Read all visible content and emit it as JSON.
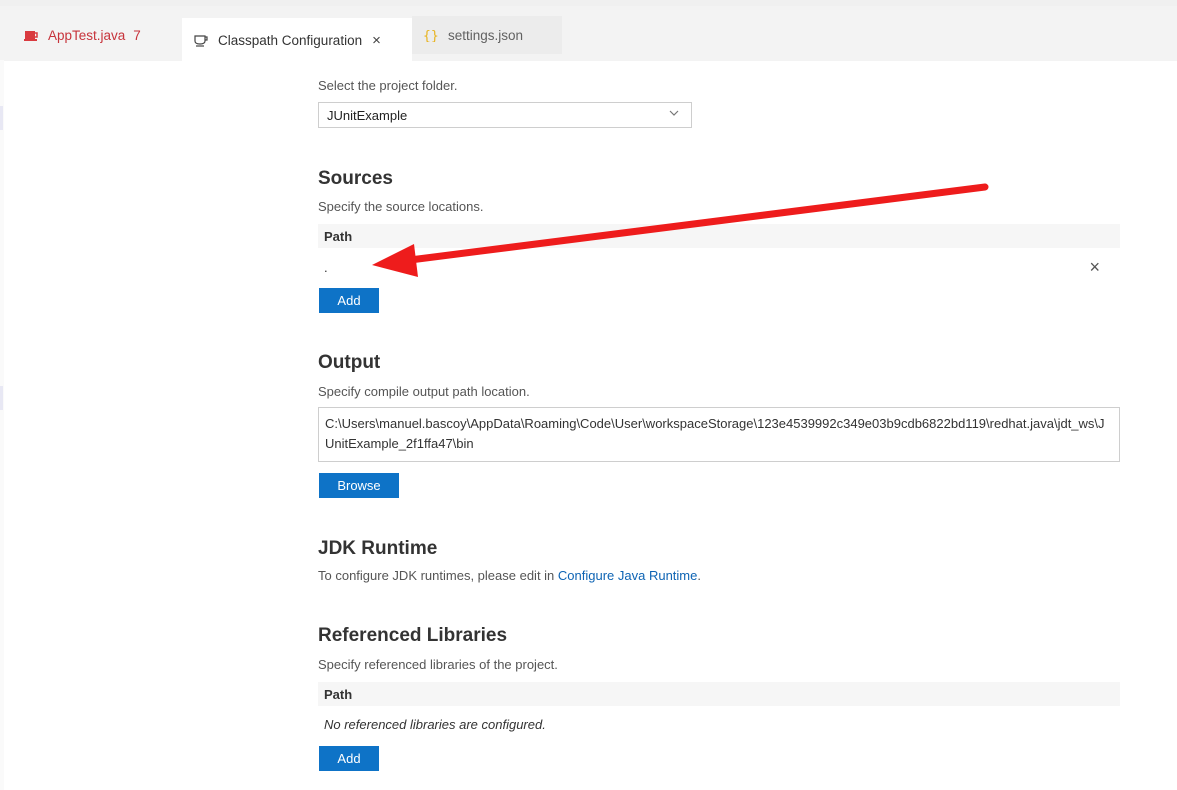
{
  "tabs": [
    {
      "label": "AppTest.java",
      "badge": "7",
      "icon": "java-icon"
    },
    {
      "label": "Classpath Configuration",
      "icon": "coffee-icon",
      "close": "×"
    },
    {
      "label": "settings.json",
      "icon": "json-braces-icon"
    }
  ],
  "project": {
    "label": "Select the project folder.",
    "selected": "JUnitExample"
  },
  "sources": {
    "title": "Sources",
    "description": "Specify the source locations.",
    "column": "Path",
    "rows": [
      "."
    ],
    "remove": "×",
    "add_label": "Add"
  },
  "output": {
    "title": "Output",
    "description": "Specify compile output path location.",
    "path": "C:\\Users\\manuel.bascoy\\AppData\\Roaming\\Code\\User\\workspaceStorage\\123e4539992c349e03b9cdb6822bd119\\redhat.java\\jdt_ws\\JUnitExample_2f1ffa47\\bin",
    "browse_label": "Browse"
  },
  "jdk": {
    "title": "JDK Runtime",
    "text": "To configure JDK runtimes, please edit in ",
    "link": "Configure Java Runtime",
    "suffix": "."
  },
  "libraries": {
    "title": "Referenced Libraries",
    "description": "Specify referenced libraries of the project.",
    "column": "Path",
    "empty": "No referenced libraries are configured.",
    "add_label": "Add"
  },
  "colors": {
    "accent": "#0e73c7",
    "annotation": "#ee1c1c",
    "error": "#c7333b"
  }
}
